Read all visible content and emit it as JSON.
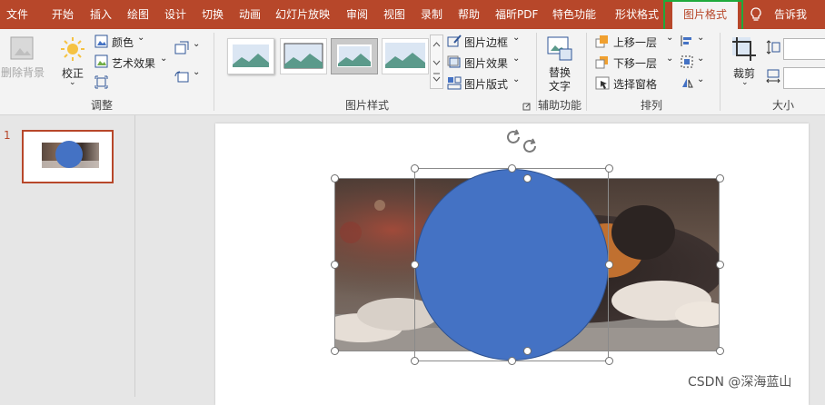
{
  "menu": {
    "tabs": [
      "文件",
      "开始",
      "插入",
      "绘图",
      "设计",
      "切换",
      "动画",
      "幻灯片放映",
      "审阅",
      "视图",
      "录制",
      "帮助",
      "福昕PDF",
      "特色功能",
      "形状格式",
      "图片格式",
      "告诉我"
    ],
    "active_tab": "图片格式"
  },
  "ribbon": {
    "remove_bg": "删除背景",
    "correct": "校正",
    "color": "颜色",
    "art_effect": "艺术效果",
    "group_adjust": "调整",
    "border": "图片边框",
    "effect": "图片效果",
    "layout": "图片版式",
    "group_styles": "图片样式",
    "alt_text_line1": "替换",
    "alt_text_line2": "文字",
    "group_accessibility": "辅助功能",
    "bring_forward": "上移一层",
    "send_backward": "下移一层",
    "selection_pane": "选择窗格",
    "group_arrange": "排列",
    "crop": "裁剪",
    "group_size": "大小"
  },
  "slides": {
    "number": "1"
  },
  "watermark": "CSDN @深海蓝山",
  "colors": {
    "accent": "#b7472a",
    "circle": "#4472c4",
    "highlight": "#1faa3c"
  }
}
